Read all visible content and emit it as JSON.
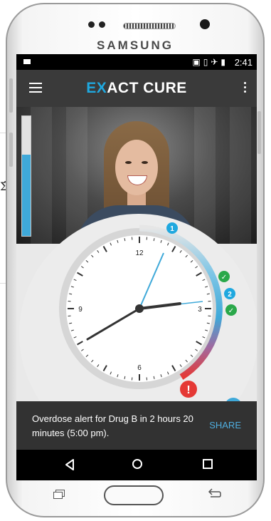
{
  "background": {
    "glyph": "Σ̂"
  },
  "device": {
    "brand": "SAMSUNG"
  },
  "status_bar": {
    "time": "2:41",
    "icons": [
      "cast-icon",
      "vibrate-icon",
      "airplane-icon",
      "battery-icon"
    ]
  },
  "app_bar": {
    "logo_prefix": "EX",
    "logo_rest": "ACT CURE",
    "menu_icon": "hamburger-icon",
    "overflow_icon": "kebab-icon"
  },
  "profile": {
    "photo": "woman-portrait",
    "progress": 0.68
  },
  "clock": {
    "labels": [
      "12",
      "3",
      "6",
      "9"
    ],
    "markers": [
      {
        "type": "number",
        "text": "1",
        "color": "#1fa8df"
      },
      {
        "type": "check",
        "color": "#2aa84a"
      },
      {
        "type": "number",
        "text": "2",
        "color": "#1fa8df"
      },
      {
        "type": "check",
        "color": "#2aa84a"
      },
      {
        "type": "alert",
        "text": "!",
        "color": "#e53935"
      }
    ],
    "accent": "#3fa9d9",
    "warning": "#e53935"
  },
  "snackbar": {
    "message": "Overdose alert for Drug B in 2 hours 20 minutes (5:00 pm).",
    "action": "SHARE"
  },
  "nav_bar": {
    "icons": [
      "back-icon",
      "home-icon",
      "recents-icon"
    ]
  }
}
